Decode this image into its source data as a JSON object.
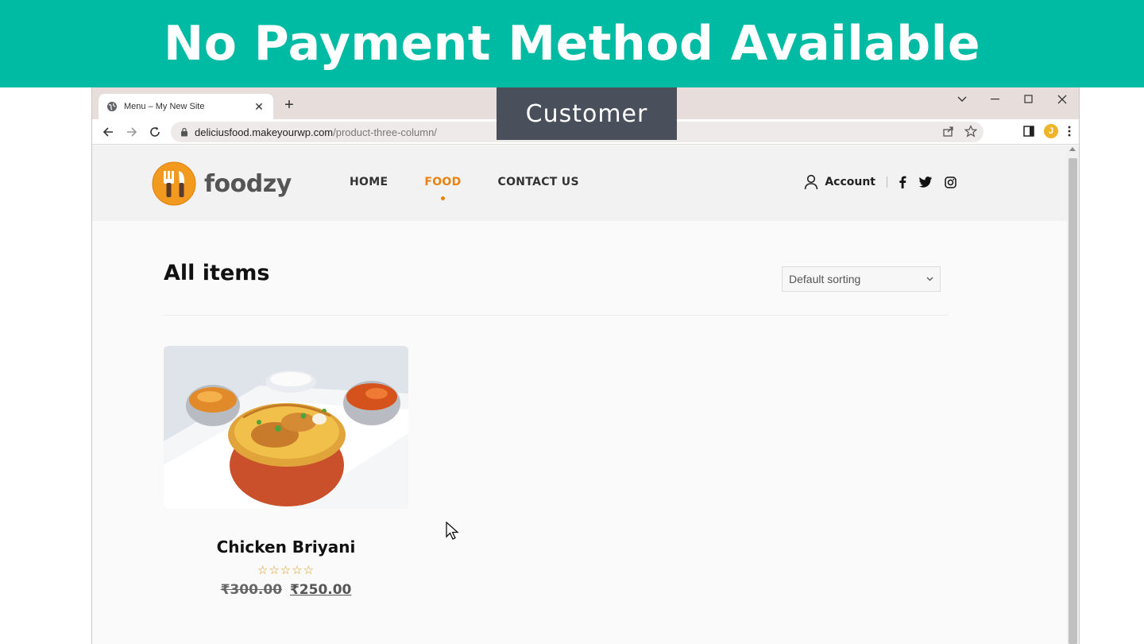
{
  "banner": {
    "title": "No Payment Method Available"
  },
  "overlay": {
    "label": "Customer"
  },
  "browser": {
    "tab_title": "Menu – My New Site",
    "url_host": "deliciusfood.makeyourwp.com",
    "url_path": "/product-three-column/",
    "avatar_initial": "J"
  },
  "site": {
    "logo_text": "foodzy",
    "nav": [
      "HOME",
      "FOOD",
      "CONTACT US"
    ],
    "active_nav": "FOOD",
    "account_label": "Account",
    "social_icons": [
      "facebook-icon",
      "twitter-icon",
      "instagram-icon"
    ]
  },
  "main": {
    "title": "All items",
    "sort_value": "Default sorting"
  },
  "product": {
    "name": "Chicken Briyani",
    "rating_stars": "☆☆☆☆☆",
    "old_price": "₹300.00",
    "new_price": "₹250.00"
  },
  "colors": {
    "banner": "#00bba3",
    "accent": "#e8820c",
    "overlay": "#4a4f5c"
  }
}
